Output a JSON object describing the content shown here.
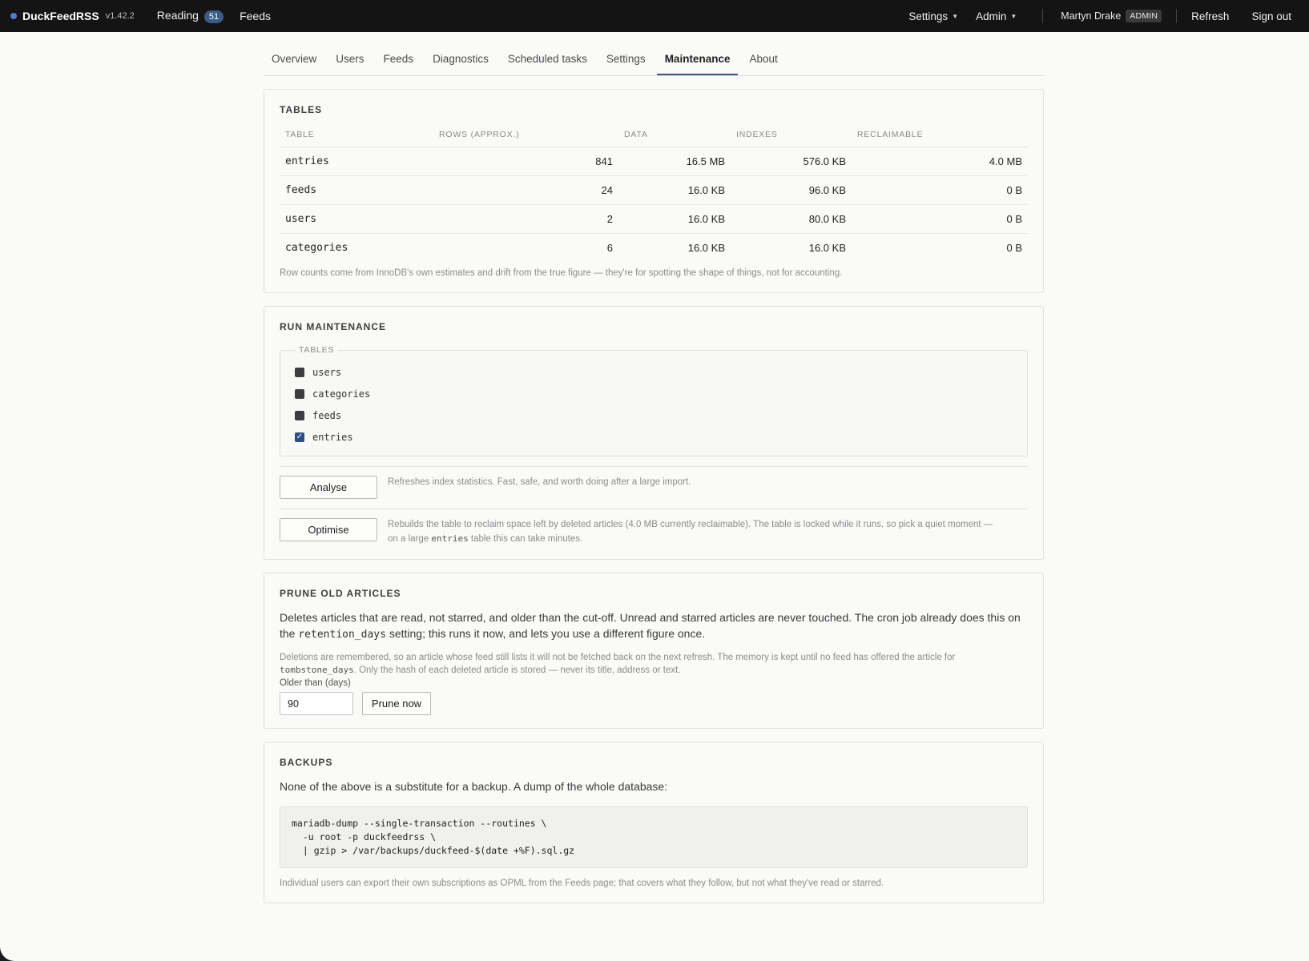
{
  "topbar": {
    "brand": "DuckFeedRSS",
    "version": "v1.42.2",
    "nav": [
      {
        "label": "Reading",
        "badge": "51"
      },
      {
        "label": "Feeds"
      }
    ],
    "menus": [
      {
        "label": "Settings"
      },
      {
        "label": "Admin"
      }
    ],
    "user": {
      "name": "Martyn Drake",
      "role": "ADMIN"
    },
    "refresh_label": "Refresh",
    "signout_label": "Sign out",
    "brand_dot_color": "#4f7bd1"
  },
  "tabs": [
    {
      "label": "Overview",
      "active": false
    },
    {
      "label": "Users",
      "active": false
    },
    {
      "label": "Feeds",
      "active": false
    },
    {
      "label": "Diagnostics",
      "active": false
    },
    {
      "label": "Scheduled tasks",
      "active": false
    },
    {
      "label": "Settings",
      "active": false
    },
    {
      "label": "Maintenance",
      "active": true
    },
    {
      "label": "About",
      "active": false
    }
  ],
  "tables_card": {
    "title": "TABLES",
    "columns": [
      "TABLE",
      "ROWS (APPROX.)",
      "DATA",
      "INDEXES",
      "RECLAIMABLE"
    ],
    "rows": [
      {
        "table": "entries",
        "rows": "841",
        "data": "16.5 MB",
        "indexes": "576.0 KB",
        "reclaimable": "4.0 MB"
      },
      {
        "table": "feeds",
        "rows": "24",
        "data": "16.0 KB",
        "indexes": "96.0 KB",
        "reclaimable": "0 B"
      },
      {
        "table": "users",
        "rows": "2",
        "data": "16.0 KB",
        "indexes": "80.0 KB",
        "reclaimable": "0 B"
      },
      {
        "table": "categories",
        "rows": "6",
        "data": "16.0 KB",
        "indexes": "16.0 KB",
        "reclaimable": "0 B"
      }
    ],
    "note": "Row counts come from InnoDB's own estimates and drift from the true figure — they're for spotting the shape of things, not for accounting."
  },
  "run_maintenance": {
    "title": "RUN MAINTENANCE",
    "legend": "TABLES",
    "checkboxes": [
      {
        "label": "users",
        "checked": false
      },
      {
        "label": "categories",
        "checked": false
      },
      {
        "label": "feeds",
        "checked": false
      },
      {
        "label": "entries",
        "checked": true
      }
    ],
    "analyse": {
      "label": "Analyse",
      "desc": "Refreshes index statistics. Fast, safe, and worth doing after a large import."
    },
    "optimise": {
      "label": "Optimise",
      "desc_1": "Rebuilds the table to reclaim space left by deleted articles (4.0 MB currently reclaimable). The table is locked while it runs, so pick a quiet moment —",
      "desc_2a": "on a large ",
      "desc_2code": "entries",
      "desc_2b": " table this can take minutes."
    }
  },
  "prune": {
    "title": "PRUNE OLD ARTICLES",
    "body_1": "Deletes articles that are read, not starred, and older than the cut-off. Unread and starred articles are never touched. The cron job already does this on",
    "body_2a": "the ",
    "body_2code": "retention_days",
    "body_2b": " setting; this runs it now, and lets you use a different figure once.",
    "note_1": "Deletions are remembered, so an article whose feed still lists it will not be fetched back on the next refresh. The memory is kept until no feed has offered the article for",
    "note_2code": "tombstone_days",
    "note_2b": ". Only the hash of each deleted article is stored — never its title, address or text.",
    "input_label": "Older than (days)",
    "input_value": "90",
    "button_label": "Prune now"
  },
  "backups": {
    "title": "BACKUPS",
    "body": "None of the above is a substitute for a backup. A dump of the whole database:",
    "code": "mariadb-dump --single-transaction --routines \\\n  -u root -p duckfeedrss \\\n  | gzip > /var/backups/duckfeed-$(date +%F).sql.gz",
    "note": "Individual users can export their own subscriptions as OPML from the Feeds page; that covers what they follow, but not what they've read or starred."
  }
}
